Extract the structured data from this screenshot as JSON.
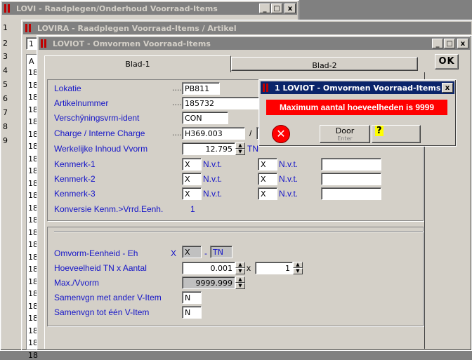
{
  "windows": {
    "lovi": {
      "title": "LOVI - Raadplegen/Onderhoud Voorraad-Items"
    },
    "lovira": {
      "title": "LOVIRA - Raadplegen Voorraad-Items / Artikel"
    },
    "loviot": {
      "title": "LOVIOT - Omvormen Voorraad-Items"
    }
  },
  "title_buttons": {
    "minimize": "_",
    "maximize": "□",
    "close": "x"
  },
  "lovi_rows": [
    "1",
    "2",
    "3",
    "4",
    "5",
    "6",
    "7",
    "8",
    "9"
  ],
  "lovira_field": "1",
  "lovira_header": "A",
  "lovira_rows": [
    "18",
    "18",
    "18",
    "18",
    "18",
    "18",
    "18",
    "18",
    "18",
    "18",
    "18",
    "18",
    "18",
    "18",
    "18",
    "18",
    "18",
    "18",
    "18",
    "18",
    "18",
    "18",
    "18",
    "18"
  ],
  "tabs": {
    "tab1": "Blad-1",
    "tab2": "Blad-2"
  },
  "ok_button": "OK",
  "form": {
    "lokatie": {
      "label": "Lokatie",
      "value": "PB811"
    },
    "artikelnummer": {
      "label": "Artikelnummer",
      "value": "185732"
    },
    "verschijning": {
      "label": "Verschÿningsvrm-ident",
      "value": "CON"
    },
    "charge": {
      "label": "Charge / Interne Charge",
      "value": "H369.003",
      "separator": "/"
    },
    "inhoud": {
      "label": "Werkelijke Inhoud Vvorm",
      "value": "12.795",
      "unit": "TN"
    },
    "kenmerk1": {
      "label": "Kenmerk-1",
      "a": "X",
      "a_txt": "N.v.t.",
      "b": "X",
      "b_txt": "N.v.t.",
      "c": ""
    },
    "kenmerk2": {
      "label": "Kenmerk-2",
      "a": "X",
      "a_txt": "N.v.t.",
      "b": "X",
      "b_txt": "N.v.t.",
      "c": ""
    },
    "kenmerk3": {
      "label": "Kenmerk-3",
      "a": "X",
      "a_txt": "N.v.t.",
      "b": "X",
      "b_txt": "N.v.t.",
      "c": ""
    },
    "konversie": {
      "label": "Konversie Kenm.>Vrrd.Eenh.",
      "value": "1"
    },
    "omvorm_eenheid": {
      "label": "Omvorm-Eenheid - Eh",
      "x_label": "X",
      "value": "X",
      "dash": "-",
      "unit": "TN"
    },
    "hoeveelheid": {
      "label": "Hoeveelheid TN x Aantal",
      "value": "0.001",
      "times": "x",
      "aantal": "1"
    },
    "max": {
      "label": "Max./Vvorm",
      "value": "9999.999"
    },
    "samenvgn_ander": {
      "label": "Samenvgn met ander V-Item",
      "value": "N"
    },
    "samenvgn_een": {
      "label": "Samenvgn tot één V-Item",
      "value": "N"
    }
  },
  "dialog": {
    "title": "1 LOVIOT - Omvormen Voorraad-Items",
    "message": "Maximum aantal hoeveelheden is 9999",
    "door_label": "Door",
    "door_sub": "Enter",
    "help_label": "?"
  },
  "colors": {
    "label_blue": "#1515c8",
    "error_red": "#ff0000",
    "title_active": "#0a246a"
  }
}
